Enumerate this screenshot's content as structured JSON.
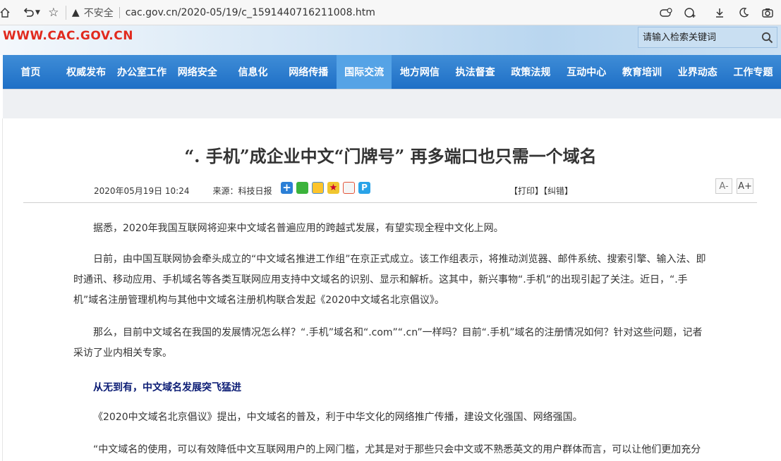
{
  "browser": {
    "security_label": "不安全",
    "url": "cac.gov.cn/2020-05/19/c_1591440716211008.htm"
  },
  "site": {
    "logo_text": "WWW.CAC.GOV.CN",
    "search_placeholder": "请输入检索关键词"
  },
  "nav": {
    "items": [
      "首页",
      "权威发布",
      "办公室工作",
      "网络安全",
      "信息化",
      "网络传播",
      "国际交流",
      "地方网信",
      "执法督查",
      "政策法规",
      "互动中心",
      "教育培训",
      "业界动态",
      "工作专题"
    ],
    "active": "国际交流"
  },
  "article": {
    "title": "“. 手机”成企业中文“门牌号”  再多端口也只需一个域名",
    "datetime": "2020年05月19日 10:24",
    "source": "来源：科技日报",
    "print_label": "【打印】",
    "error_label": "【纠错】",
    "font_smaller": "A-",
    "font_larger": "A+",
    "paragraphs": [
      "据悉，2020年我国互联网将迎来中文域名普遍应用的跨越式发展，有望实现全程中文化上网。",
      "日前，由中国互联网协会牵头成立的“中文域名推进工作组”在京正式成立。该工作组表示，将推动浏览器、邮件系统、搜索引擎、输入法、即时通讯、移动应用、手机域名等各类互联网应用支持中文域名的识别、显示和解析。这其中，新兴事物“.手机”的出现引起了关注。近日，“.手机”域名注册管理机构与其他中文域名注册机构联合发起《2020中文域名北京倡议》。",
      "那么，目前中文域名在我国的发展情况怎么样？“.手机”域名和“.com”“.cn”一样吗？目前“.手机”域名的注册情况如何？针对这些问题，记者采访了业内相关专家。"
    ],
    "subheading": "从无到有，中文域名发展突飞猛进",
    "paragraphs2": [
      "《2020中文域名北京倡议》提出，中文域名的普及，利于中华文化的网络推广传播，建设文化强国、网络强国。",
      "“中文域名的使用，可以有效降低中文互联网用户的上网门槛，尤其是对于那些只会中文或不熟悉英文的用户群体而言，可以让他们更加充分"
    ]
  },
  "share_icons": [
    "share-plus-icon",
    "wechat-icon",
    "qzone-icon",
    "favorite-star-icon",
    "weibo-icon",
    "share-p-icon"
  ],
  "colors": {
    "nav": "#2a7dd0",
    "nav_active": "#55a3e6",
    "logo": "#e12a1e",
    "subheading": "#0c1d75"
  }
}
